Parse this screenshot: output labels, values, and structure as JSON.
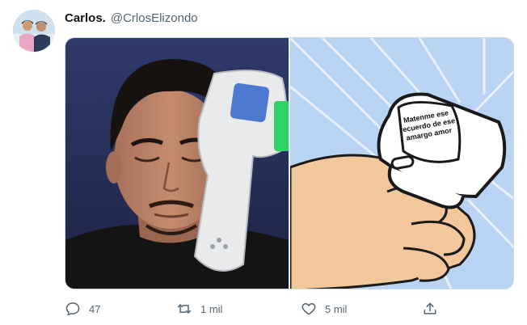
{
  "tweet": {
    "author": {
      "display_name": "Carlos.",
      "handle": "@CrlosElizondo",
      "avatar_icon": "profile-photo"
    },
    "media": {
      "left_image": "man-with-forehead-thermometer",
      "right_image": "hand-holding-thermometer-cartoon",
      "meme_text": "Matenme ese recuerdo de ese amargo amor"
    },
    "actions": {
      "reply_count": "47",
      "retweet_count": "1 mil",
      "like_count": "5 mil"
    }
  },
  "colors": {
    "text_primary": "#0f1419",
    "text_secondary": "#536471",
    "border": "#cfd9de",
    "thermometer_screen": "#2fd36a",
    "cartoon_sky": "#b9d3f3"
  }
}
